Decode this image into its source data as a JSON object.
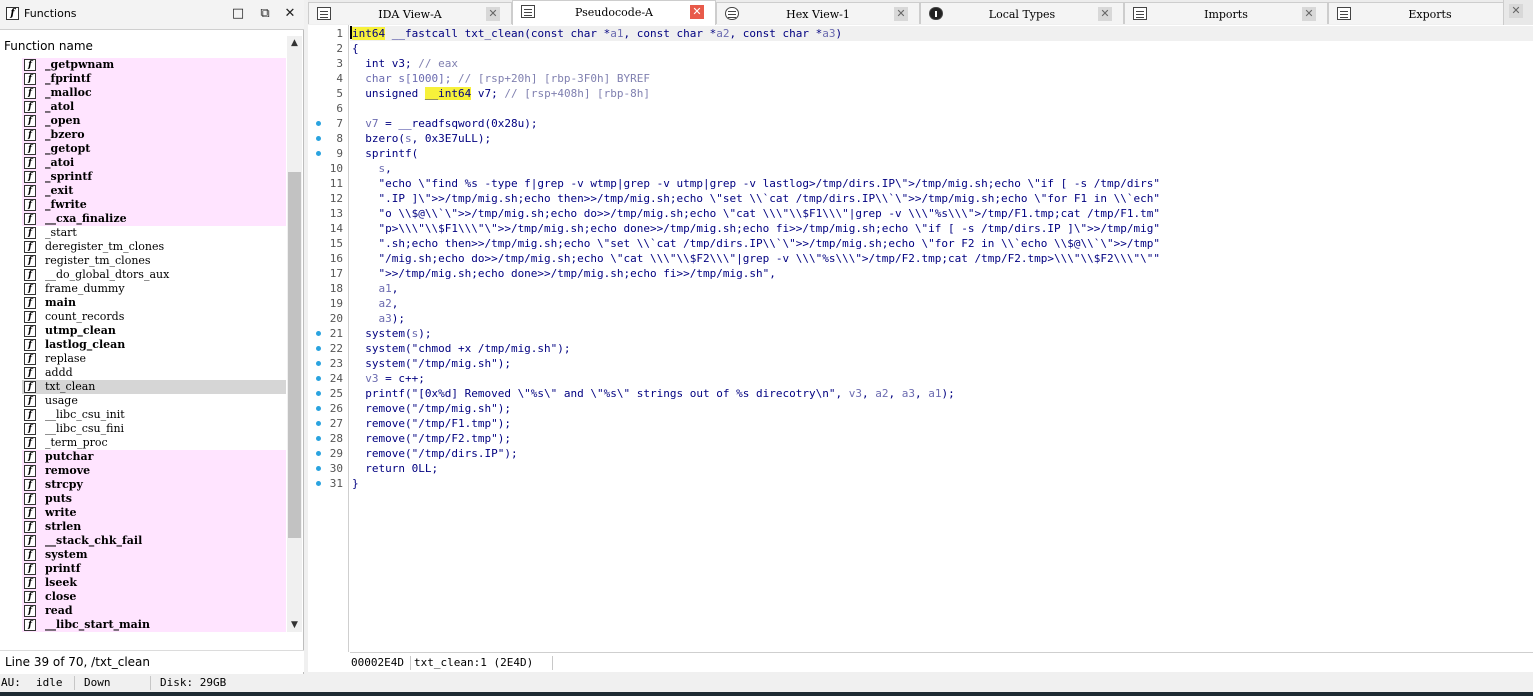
{
  "functions_panel": {
    "title": "Functions",
    "column_header": "Function name",
    "status": "Line 39 of 70, /txt_clean",
    "items": [
      {
        "name": "_getpwnam",
        "lib": true
      },
      {
        "name": "_fprintf",
        "lib": true
      },
      {
        "name": "_malloc",
        "lib": true
      },
      {
        "name": "_atol",
        "lib": true
      },
      {
        "name": "_open",
        "lib": true
      },
      {
        "name": "_bzero",
        "lib": true
      },
      {
        "name": "_getopt",
        "lib": true
      },
      {
        "name": "_atoi",
        "lib": true
      },
      {
        "name": "_sprintf",
        "lib": true
      },
      {
        "name": "_exit",
        "lib": true
      },
      {
        "name": "_fwrite",
        "lib": true
      },
      {
        "name": "__cxa_finalize",
        "lib": true
      },
      {
        "name": "_start",
        "lib": false
      },
      {
        "name": "deregister_tm_clones",
        "lib": false
      },
      {
        "name": "register_tm_clones",
        "lib": false
      },
      {
        "name": "__do_global_dtors_aux",
        "lib": false
      },
      {
        "name": "frame_dummy",
        "lib": false
      },
      {
        "name": "main",
        "lib": false,
        "bold": true
      },
      {
        "name": "count_records",
        "lib": false
      },
      {
        "name": "utmp_clean",
        "lib": false,
        "bold": true
      },
      {
        "name": "lastlog_clean",
        "lib": false,
        "bold": true
      },
      {
        "name": "replase",
        "lib": false
      },
      {
        "name": "addd",
        "lib": false
      },
      {
        "name": "txt_clean",
        "lib": false,
        "selected": true
      },
      {
        "name": "usage",
        "lib": false
      },
      {
        "name": "__libc_csu_init",
        "lib": false
      },
      {
        "name": "__libc_csu_fini",
        "lib": false
      },
      {
        "name": "_term_proc",
        "lib": false
      },
      {
        "name": "putchar",
        "lib": true
      },
      {
        "name": "remove",
        "lib": true
      },
      {
        "name": "strcpy",
        "lib": true
      },
      {
        "name": "puts",
        "lib": true
      },
      {
        "name": "write",
        "lib": true
      },
      {
        "name": "strlen",
        "lib": true
      },
      {
        "name": "__stack_chk_fail",
        "lib": true
      },
      {
        "name": "system",
        "lib": true
      },
      {
        "name": "printf",
        "lib": true
      },
      {
        "name": "lseek",
        "lib": true
      },
      {
        "name": "close",
        "lib": true
      },
      {
        "name": "read",
        "lib": true
      },
      {
        "name": "__libc_start_main",
        "lib": true
      }
    ]
  },
  "tabs": [
    {
      "label": "IDA View-A",
      "icon": "listing-icon",
      "active": false
    },
    {
      "label": "Pseudocode-A",
      "icon": "listing-icon",
      "active": true
    },
    {
      "label": "Hex View-1",
      "icon": "hex-icon",
      "active": false
    },
    {
      "label": "Local Types",
      "icon": "info-icon",
      "active": false
    },
    {
      "label": "Imports",
      "icon": "listing-icon",
      "active": false
    },
    {
      "label": "Exports",
      "icon": "listing-icon",
      "active": false
    }
  ],
  "code": {
    "lines": [
      {
        "n": "1",
        "dot": false,
        "html": "<span class='caret'></span><span class='hl kw'>int64</span><span class='kw'> __fastcall txt_clean(const char *</span><span class='var'>a1</span><span class='kw'>, const char *</span><span class='var'>a2</span><span class='kw'>, const char *</span><span class='var'>a3</span><span class='kw'>)</span>"
      },
      {
        "n": "2",
        "dot": false,
        "html": "<span class='kw'>{</span>"
      },
      {
        "n": "3",
        "dot": false,
        "html": "<span class='kw'>  int v3; </span><span class='com'>// eax</span>"
      },
      {
        "n": "4",
        "dot": false,
        "html": "<span class='var'>  char s[1000]; </span><span class='com'>// [rsp+20h] [rbp-3F0h] BYREF</span>"
      },
      {
        "n": "5",
        "dot": false,
        "html": "<span class='kw'>  unsigned </span><span class='hl kw'>__int64</span><span class='kw'> v7; </span><span class='com'>// [rsp+408h] [rbp-8h]</span>"
      },
      {
        "n": "6",
        "dot": false,
        "html": ""
      },
      {
        "n": "7",
        "dot": true,
        "html": "<span class='var'>  v7</span><span class='kw'> = __readfsqword(0x28u);</span>"
      },
      {
        "n": "8",
        "dot": true,
        "html": "<span class='kw'>  bzero(</span><span class='var'>s</span><span class='kw'>, 0x3E7uLL);</span>"
      },
      {
        "n": "9",
        "dot": true,
        "html": "<span class='kw'>  sprintf(</span>"
      },
      {
        "n": "10",
        "dot": false,
        "html": "<span class='var'>    s</span><span class='kw'>,</span>"
      },
      {
        "n": "11",
        "dot": false,
        "html": "<span class='str'>    \"echo \\\"find %s -type f|grep -v wtmp|grep -v utmp|grep -v lastlog&gt;/tmp/dirs.IP\\\"&gt;/tmp/mig.sh;echo \\\"if [ -s /tmp/dirs\"</span>"
      },
      {
        "n": "12",
        "dot": false,
        "html": "<span class='str'>    \".IP ]\\\"&gt;&gt;/tmp/mig.sh;echo then&gt;&gt;/tmp/mig.sh;echo \\\"set \\\\`cat /tmp/dirs.IP\\\\`\\\"&gt;&gt;/tmp/mig.sh;echo \\\"for F1 in \\\\`ech\"</span>"
      },
      {
        "n": "13",
        "dot": false,
        "html": "<span class='str'>    \"o \\\\$@\\\\`\\\"&gt;&gt;/tmp/mig.sh;echo do&gt;&gt;/tmp/mig.sh;echo \\\"cat \\\\\\\"\\\\$F1\\\\\\\"|grep -v \\\\\\\"%s\\\\\\\"&gt;/tmp/F1.tmp;cat /tmp/F1.tm\"</span>"
      },
      {
        "n": "14",
        "dot": false,
        "html": "<span class='str'>    \"p&gt;\\\\\\\"\\\\$F1\\\\\\\"\\\"&gt;&gt;/tmp/mig.sh;echo done&gt;&gt;/tmp/mig.sh;echo fi&gt;&gt;/tmp/mig.sh;echo \\\"if [ -s /tmp/dirs.IP ]\\\"&gt;&gt;/tmp/mig\"</span>"
      },
      {
        "n": "15",
        "dot": false,
        "html": "<span class='str'>    \".sh;echo then&gt;&gt;/tmp/mig.sh;echo \\\"set \\\\`cat /tmp/dirs.IP\\\\`\\\"&gt;&gt;/tmp/mig.sh;echo \\\"for F2 in \\\\`echo \\\\$@\\\\`\\\"&gt;&gt;/tmp\"</span>"
      },
      {
        "n": "16",
        "dot": false,
        "html": "<span class='str'>    \"/mig.sh;echo do&gt;&gt;/tmp/mig.sh;echo \\\"cat \\\\\\\"\\\\$F2\\\\\\\"|grep -v \\\\\\\"%s\\\\\\\"&gt;/tmp/F2.tmp;cat /tmp/F2.tmp&gt;\\\\\\\"\\\\$F2\\\\\\\"\\\"\"</span>"
      },
      {
        "n": "17",
        "dot": false,
        "html": "<span class='str'>    \"&gt;&gt;/tmp/mig.sh;echo done&gt;&gt;/tmp/mig.sh;echo fi&gt;&gt;/tmp/mig.sh\"</span><span class='kw'>,</span>"
      },
      {
        "n": "18",
        "dot": false,
        "html": "<span class='var'>    a1</span><span class='kw'>,</span>"
      },
      {
        "n": "19",
        "dot": false,
        "html": "<span class='var'>    a2</span><span class='kw'>,</span>"
      },
      {
        "n": "20",
        "dot": false,
        "html": "<span class='var'>    a3</span><span class='kw'>);</span>"
      },
      {
        "n": "21",
        "dot": true,
        "html": "<span class='kw'>  system(</span><span class='var'>s</span><span class='kw'>);</span>"
      },
      {
        "n": "22",
        "dot": true,
        "html": "<span class='kw'>  system(\"chmod +x /tmp/mig.sh\");</span>"
      },
      {
        "n": "23",
        "dot": true,
        "html": "<span class='kw'>  system(\"/tmp/mig.sh\");</span>"
      },
      {
        "n": "24",
        "dot": true,
        "html": "<span class='var'>  v3</span><span class='kw'> = c++;</span>"
      },
      {
        "n": "25",
        "dot": true,
        "html": "<span class='kw'>  printf(\"[0x%d] Removed \\\"%s\\\" and \\\"%s\\\" strings out of %s direcotry\\n\", </span><span class='var'>v3</span><span class='kw'>, </span><span class='var'>a2</span><span class='kw'>, </span><span class='var'>a3</span><span class='kw'>, </span><span class='var'>a1</span><span class='kw'>);</span>"
      },
      {
        "n": "26",
        "dot": true,
        "html": "<span class='kw'>  remove(\"/tmp/mig.sh\");</span>"
      },
      {
        "n": "27",
        "dot": true,
        "html": "<span class='kw'>  remove(\"/tmp/F1.tmp\");</span>"
      },
      {
        "n": "28",
        "dot": true,
        "html": "<span class='kw'>  remove(\"/tmp/F2.tmp\");</span>"
      },
      {
        "n": "29",
        "dot": true,
        "html": "<span class='kw'>  remove(\"/tmp/dirs.IP\");</span>"
      },
      {
        "n": "30",
        "dot": true,
        "html": "<span class='kw'>  return 0LL;</span>"
      },
      {
        "n": "31",
        "dot": true,
        "html": "<span class='kw'>}</span>"
      }
    ],
    "status_address": "00002E4D",
    "status_location": "txt_clean:1 (2E4D)"
  },
  "bottom_status": {
    "au": "AU:",
    "au_state": "idle",
    "direction": "Down",
    "disk": "Disk: 29GB"
  },
  "colors": {
    "library_function_bg": "#ffe4ff",
    "highlight": "#f7f13a",
    "breakpoint_dot": "#2aa3df"
  }
}
